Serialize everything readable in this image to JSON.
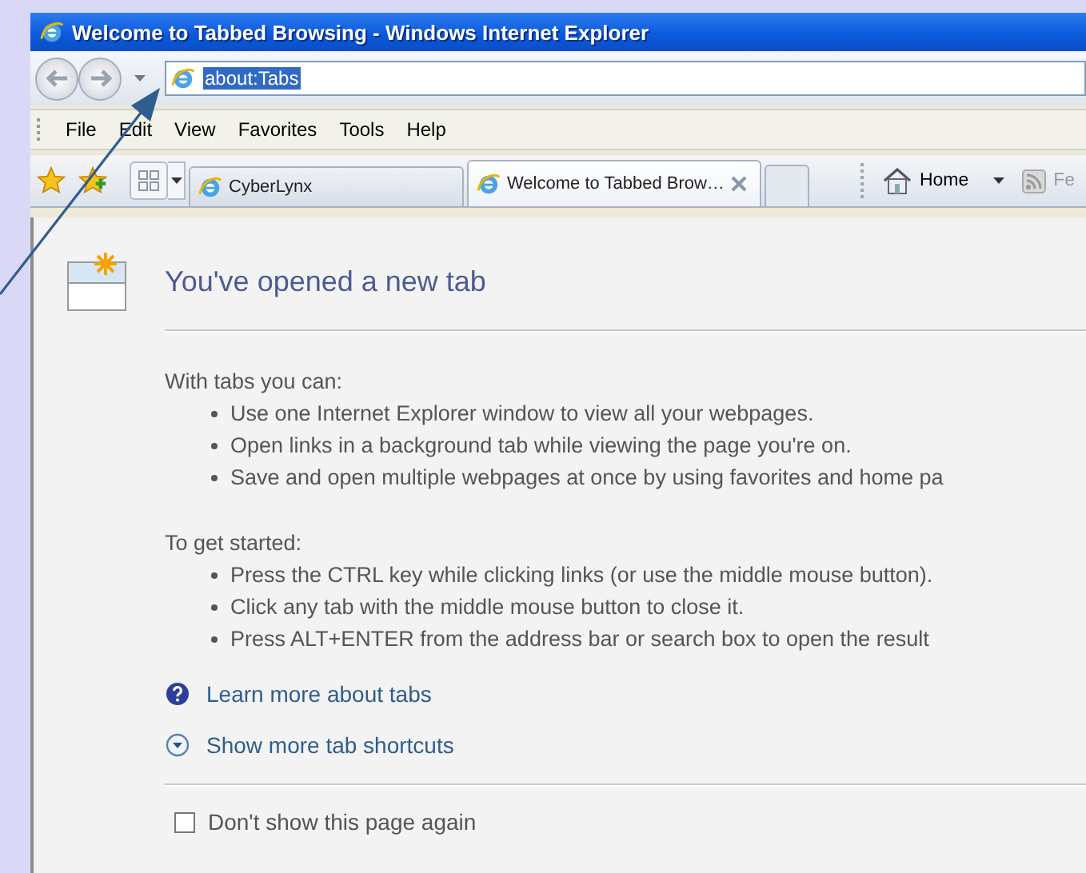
{
  "window": {
    "title": "Welcome to Tabbed Browsing - Windows Internet Explorer"
  },
  "address_bar": {
    "value": "about:Tabs",
    "selected": true
  },
  "menu": [
    "File",
    "Edit",
    "View",
    "Favorites",
    "Tools",
    "Help"
  ],
  "tabs": [
    {
      "label": "CyberLynx",
      "selected": false
    },
    {
      "label": "Welcome to Tabbed Brow…",
      "selected": true
    }
  ],
  "command_bar": {
    "home": "Home",
    "feeds": "Fe"
  },
  "page": {
    "heading": "You've opened a new tab",
    "sections": [
      {
        "title": "With tabs you can:",
        "items": [
          "Use one Internet Explorer window to view all your webpages.",
          "Open links in a background tab while viewing the page you're on.",
          "Save and open multiple webpages at once by using favorites and home pa"
        ]
      },
      {
        "title": "To get started:",
        "items": [
          "Press the CTRL key while clicking links (or use the middle mouse button).",
          "Click any tab with the middle mouse button to close it.",
          "Press ALT+ENTER from the address bar or search box to open the result"
        ]
      }
    ],
    "links": [
      {
        "kind": "help",
        "text": "Learn more about tabs"
      },
      {
        "kind": "expand",
        "text": "Show more tab shortcuts"
      }
    ],
    "checkbox": {
      "label": "Don't show this page again",
      "checked": false
    }
  }
}
